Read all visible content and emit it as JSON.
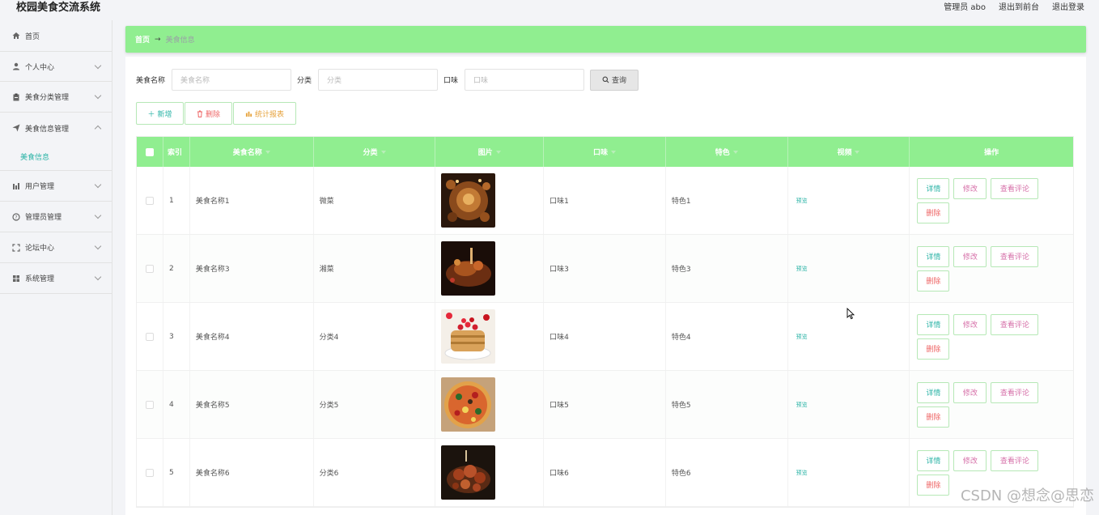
{
  "app": {
    "title": "校园美食交流系统"
  },
  "top_links": {
    "user": "管理员 abo",
    "front": "退出到前台",
    "logout": "退出登录"
  },
  "sidebar": {
    "items": [
      {
        "label": "首页",
        "icon": "home-icon"
      },
      {
        "label": "个人中心",
        "icon": "user-icon"
      },
      {
        "label": "美食分类管理",
        "icon": "clipboard-icon"
      },
      {
        "label": "美食信息管理",
        "icon": "send-icon"
      },
      {
        "label": "用户管理",
        "icon": "bar-chart-icon"
      },
      {
        "label": "管理员管理",
        "icon": "question-circle-icon"
      },
      {
        "label": "论坛中心",
        "icon": "expand-icon"
      },
      {
        "label": "系统管理",
        "icon": "grid-icon"
      }
    ],
    "submenu_active": "美食信息"
  },
  "breadcrumb": {
    "home": "首页",
    "arrow": "→",
    "current": "美食信息"
  },
  "search": {
    "name_label": "美食名称",
    "name_placeholder": "美食名称",
    "cat_label": "分类",
    "cat_placeholder": "分类",
    "taste_label": "口味",
    "taste_placeholder": "口味",
    "button": "查询"
  },
  "actions": {
    "add": "新增",
    "delete": "删除",
    "stats": "统计报表"
  },
  "table": {
    "headers": {
      "index": "索引",
      "name": "美食名称",
      "category": "分类",
      "image": "图片",
      "taste": "口味",
      "feature": "特色",
      "video": "视频",
      "ops": "操作"
    },
    "rows": [
      {
        "index": "1",
        "name": "美食名称1",
        "category": "微菜",
        "taste": "口味1",
        "feature": "特色1",
        "video": "预览"
      },
      {
        "index": "2",
        "name": "美食名称3",
        "category": "湘菜",
        "taste": "口味3",
        "feature": "特色3",
        "video": "预览"
      },
      {
        "index": "3",
        "name": "美食名称4",
        "category": "分类4",
        "taste": "口味4",
        "feature": "特色4",
        "video": "预览"
      },
      {
        "index": "4",
        "name": "美食名称5",
        "category": "分类5",
        "taste": "口味5",
        "feature": "特色5",
        "video": "预览"
      },
      {
        "index": "5",
        "name": "美食名称6",
        "category": "分类6",
        "taste": "口味6",
        "feature": "特色6",
        "video": "预览"
      }
    ],
    "op_labels": {
      "detail": "详情",
      "edit": "修改",
      "comments": "查看评论",
      "delete": "删除"
    }
  },
  "watermark": "CSDN @想念@思恋"
}
